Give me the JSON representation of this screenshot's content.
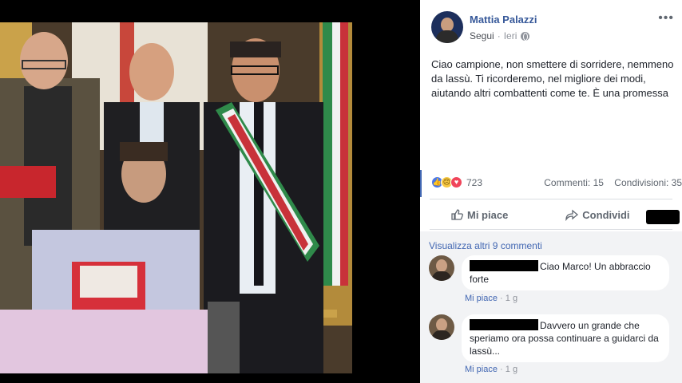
{
  "post": {
    "author_name": "Mattia Palazzi",
    "follow_label": "Segui",
    "separator": "·",
    "time": "Ieri",
    "more_label": "•••",
    "text": "Ciao campione, non smettere di sorridere, nemmeno da lassù. Ti ricorderemo, nel migliore dei modi, aiutando altri combattenti come te. È una promessa",
    "reaction_count": "723",
    "comments_count": "Commenti: 15",
    "shares_count": "Condivisioni: 35"
  },
  "actions": {
    "like_label": "Mi piace",
    "share_label": "Condividi"
  },
  "comments": {
    "view_more": "Visualizza altri 9 commenti",
    "items": [
      {
        "text": "Ciao Marco! Un abbraccio forte",
        "like_label": "Mi piace",
        "separator": "·",
        "time": "1 g"
      },
      {
        "text": "Davvero un grande che speriamo ora possa continuare a guidarci da lassù...",
        "like_label": "Mi piace",
        "separator": "·",
        "time": "1 g"
      }
    ]
  },
  "colors": {
    "link": "#365899",
    "meta": "#90949c",
    "comment_bg": "#f2f3f5"
  }
}
